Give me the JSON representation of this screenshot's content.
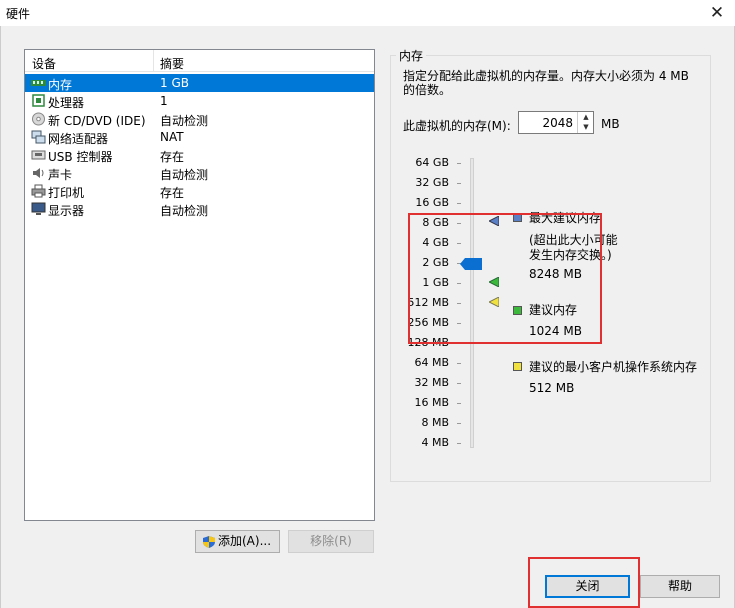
{
  "window": {
    "title": "硬件"
  },
  "device_list": {
    "headers": [
      "设备",
      "摘要"
    ],
    "items": [
      {
        "name": "内存",
        "summary": "1 GB",
        "icon": "memory-icon",
        "selected": true
      },
      {
        "name": "处理器",
        "summary": "1",
        "icon": "cpu-icon"
      },
      {
        "name": "新 CD/DVD (IDE)",
        "summary": "自动检测",
        "icon": "cd-icon"
      },
      {
        "name": "网络适配器",
        "summary": "NAT",
        "icon": "network-icon"
      },
      {
        "name": "USB 控制器",
        "summary": "存在",
        "icon": "usb-icon"
      },
      {
        "name": "声卡",
        "summary": "自动检测",
        "icon": "sound-icon"
      },
      {
        "name": "打印机",
        "summary": "存在",
        "icon": "printer-icon"
      },
      {
        "name": "显示器",
        "summary": "自动检测",
        "icon": "monitor-icon"
      }
    ]
  },
  "buttons": {
    "add": "添加(A)...",
    "remove": "移除(R)",
    "close": "关闭",
    "help": "帮助"
  },
  "memory": {
    "group_title": "内存",
    "description": "指定分配给此虚拟机的内存量。内存大小必须为 4 MB 的倍数。",
    "field_label": "此虚拟机的内存(M):",
    "value": "2048",
    "unit": "MB",
    "scale_labels": [
      "64 GB",
      "32 GB",
      "16 GB",
      "8 GB",
      "4 GB",
      "2 GB",
      "1 GB",
      "512 MB",
      "256 MB",
      "128 MB",
      "64 MB",
      "32 MB",
      "16 MB",
      "8 MB",
      "4 MB"
    ],
    "legend": {
      "max_title": "最大建议内存",
      "max_note": "(超出此大小可能发生内存交换。)",
      "max_value": "8248 MB",
      "rec_title": "建议内存",
      "rec_value": "1024 MB",
      "min_title": "建议的最小客户机操作系统内存",
      "min_value": "512 MB"
    },
    "colors": {
      "max": "#5a7fc4",
      "rec": "#3cb83c",
      "min": "#f0e040",
      "thumb": "#0a6fd0"
    }
  }
}
